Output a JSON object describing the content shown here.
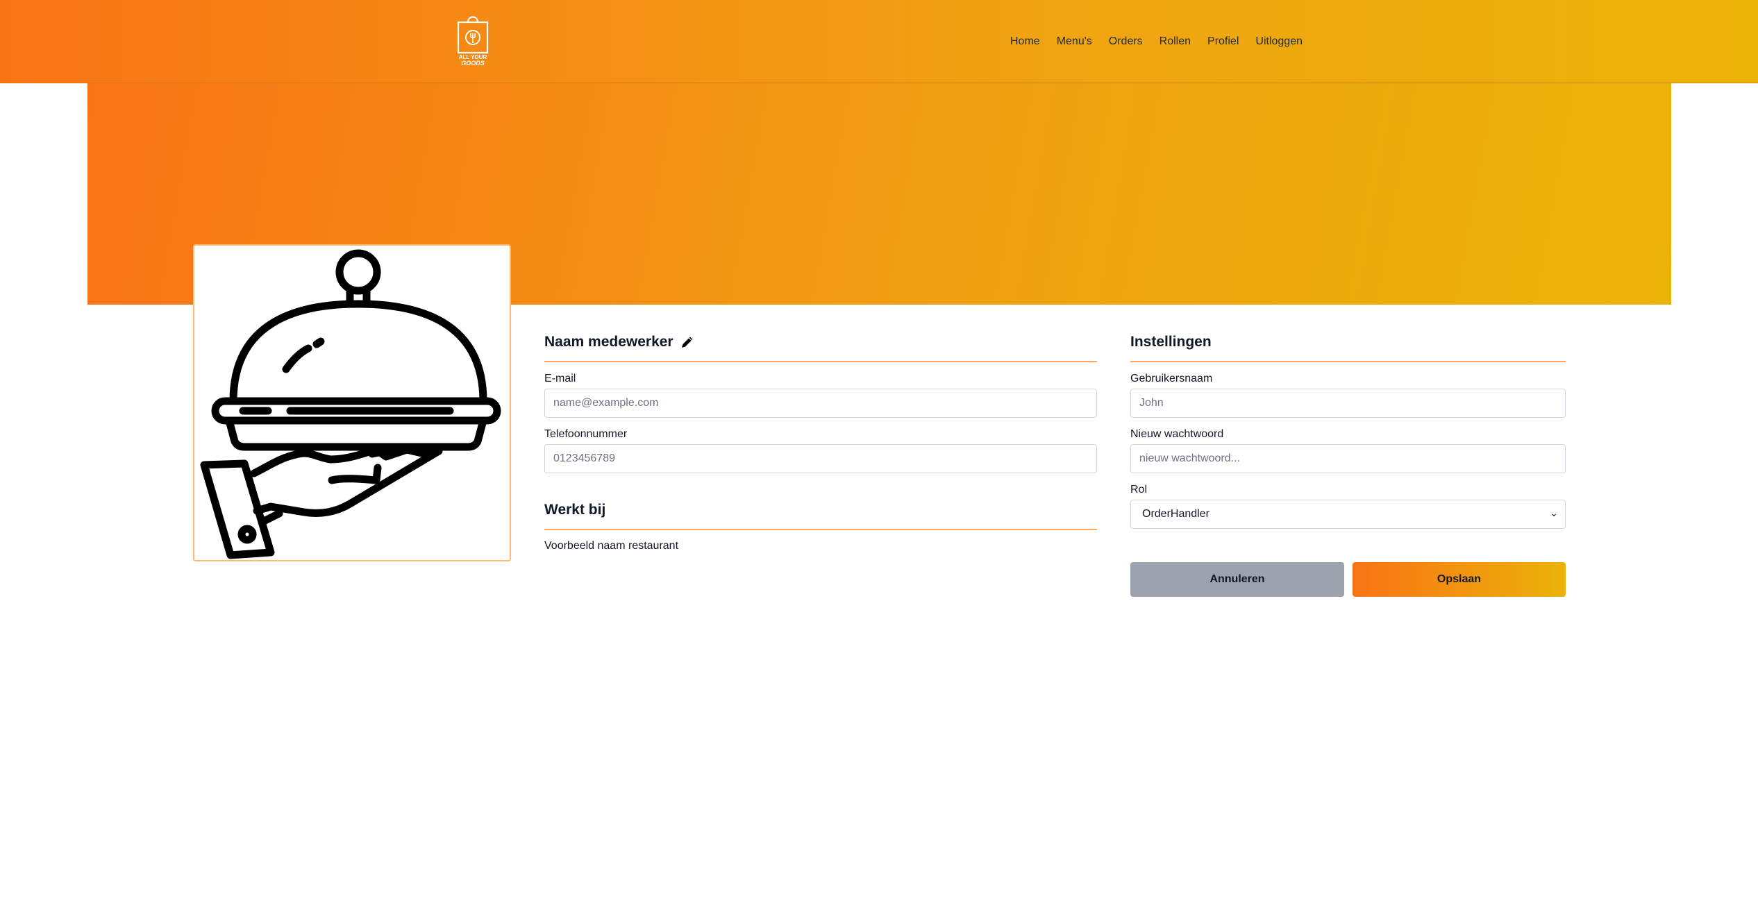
{
  "brand": {
    "logo_line1": "ALL YOUR",
    "logo_line2": "GOODS"
  },
  "nav": {
    "items": [
      {
        "label": "Home"
      },
      {
        "label": "Menu's"
      },
      {
        "label": "Orders"
      },
      {
        "label": "Rollen"
      },
      {
        "label": "Profiel"
      },
      {
        "label": "Uitloggen"
      }
    ]
  },
  "profile": {
    "title": "Naam medewerker",
    "email_label": "E-mail",
    "email_placeholder": "name@example.com",
    "phone_label": "Telefoonnummer",
    "phone_placeholder": "0123456789",
    "works_at_title": "Werkt bij",
    "works_at_value": "Voorbeeld naam restaurant"
  },
  "settings": {
    "title": "Instellingen",
    "username_label": "Gebruikersnaam",
    "username_placeholder": "John",
    "password_label": "Nieuw wachtwoord",
    "password_placeholder": "nieuw wachtwoord...",
    "role_label": "Rol",
    "role_selected": "OrderHandler"
  },
  "actions": {
    "cancel_label": "Annuleren",
    "save_label": "Opslaan"
  },
  "colors": {
    "gradient_start": "#f97316",
    "gradient_end": "#eab308",
    "cancel_button": "#9ca3af",
    "accent_rule": "#fb923c"
  },
  "icons": {
    "logo": "shopping-bag-icon",
    "edit": "pencil-icon",
    "avatar": "serving-cloche-icon",
    "select": "chevron-down-icon"
  }
}
